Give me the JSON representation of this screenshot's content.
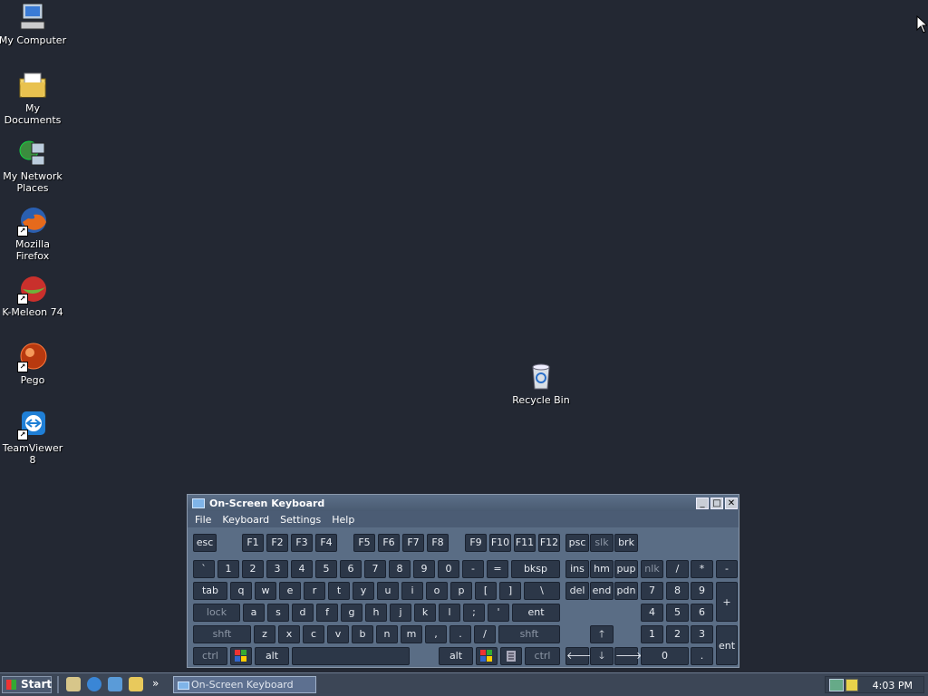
{
  "desktop": {
    "icons": [
      {
        "label": "My Computer"
      },
      {
        "label": "My Documents"
      },
      {
        "label": "My Network Places"
      },
      {
        "label": "Mozilla Firefox"
      },
      {
        "label": "K-Meleon 74"
      },
      {
        "label": "Pego"
      },
      {
        "label": "TeamViewer 8"
      },
      {
        "label": "Recycle Bin"
      }
    ]
  },
  "osk": {
    "title": "On-Screen Keyboard",
    "menu": [
      "File",
      "Keyboard",
      "Settings",
      "Help"
    ],
    "window_buttons": {
      "minimize": "_",
      "maximize": "□",
      "close": "✕"
    },
    "keys": {
      "esc": "esc",
      "f": [
        "F1",
        "F2",
        "F3",
        "F4",
        "F5",
        "F6",
        "F7",
        "F8",
        "F9",
        "F10",
        "F11",
        "F12"
      ],
      "psc": "psc",
      "slk": "slk",
      "brk": "brk",
      "row1": [
        "`",
        "1",
        "2",
        "3",
        "4",
        "5",
        "6",
        "7",
        "8",
        "9",
        "0",
        "-",
        "="
      ],
      "bksp": "bksp",
      "tab": "tab",
      "row2": [
        "q",
        "w",
        "e",
        "r",
        "t",
        "y",
        "u",
        "i",
        "o",
        "p",
        "[",
        "]",
        "\\"
      ],
      "lock": "lock",
      "row3": [
        "a",
        "s",
        "d",
        "f",
        "g",
        "h",
        "j",
        "k",
        "l",
        ";",
        "'"
      ],
      "ent": "ent",
      "shft": "shft",
      "row4": [
        "z",
        "x",
        "c",
        "v",
        "b",
        "n",
        "m",
        ",",
        ".",
        "/"
      ],
      "ctrl": "ctrl",
      "alt": "alt",
      "nav1": [
        "ins",
        "hm",
        "pup"
      ],
      "nav2": [
        "del",
        "end",
        "pdn"
      ],
      "numpad": {
        "r1": [
          "nlk",
          "/",
          "*",
          "-"
        ],
        "r2": [
          "7",
          "8",
          "9"
        ],
        "r3": [
          "4",
          "5",
          "6"
        ],
        "r4": [
          "1",
          "2",
          "3"
        ],
        "zero": "0",
        "dot": ".",
        "plus": "+",
        "enter": "ent"
      },
      "arrows": {
        "up": "🡑",
        "left": "🡐",
        "down": "🡓",
        "right": "🡒"
      }
    }
  },
  "taskbar": {
    "start_label": "Start",
    "overflow": "»",
    "task_label": "On-Screen Keyboard",
    "clock": "4:03 PM"
  },
  "colors": {
    "desktop": "#232833",
    "accent": "#5d7090"
  }
}
